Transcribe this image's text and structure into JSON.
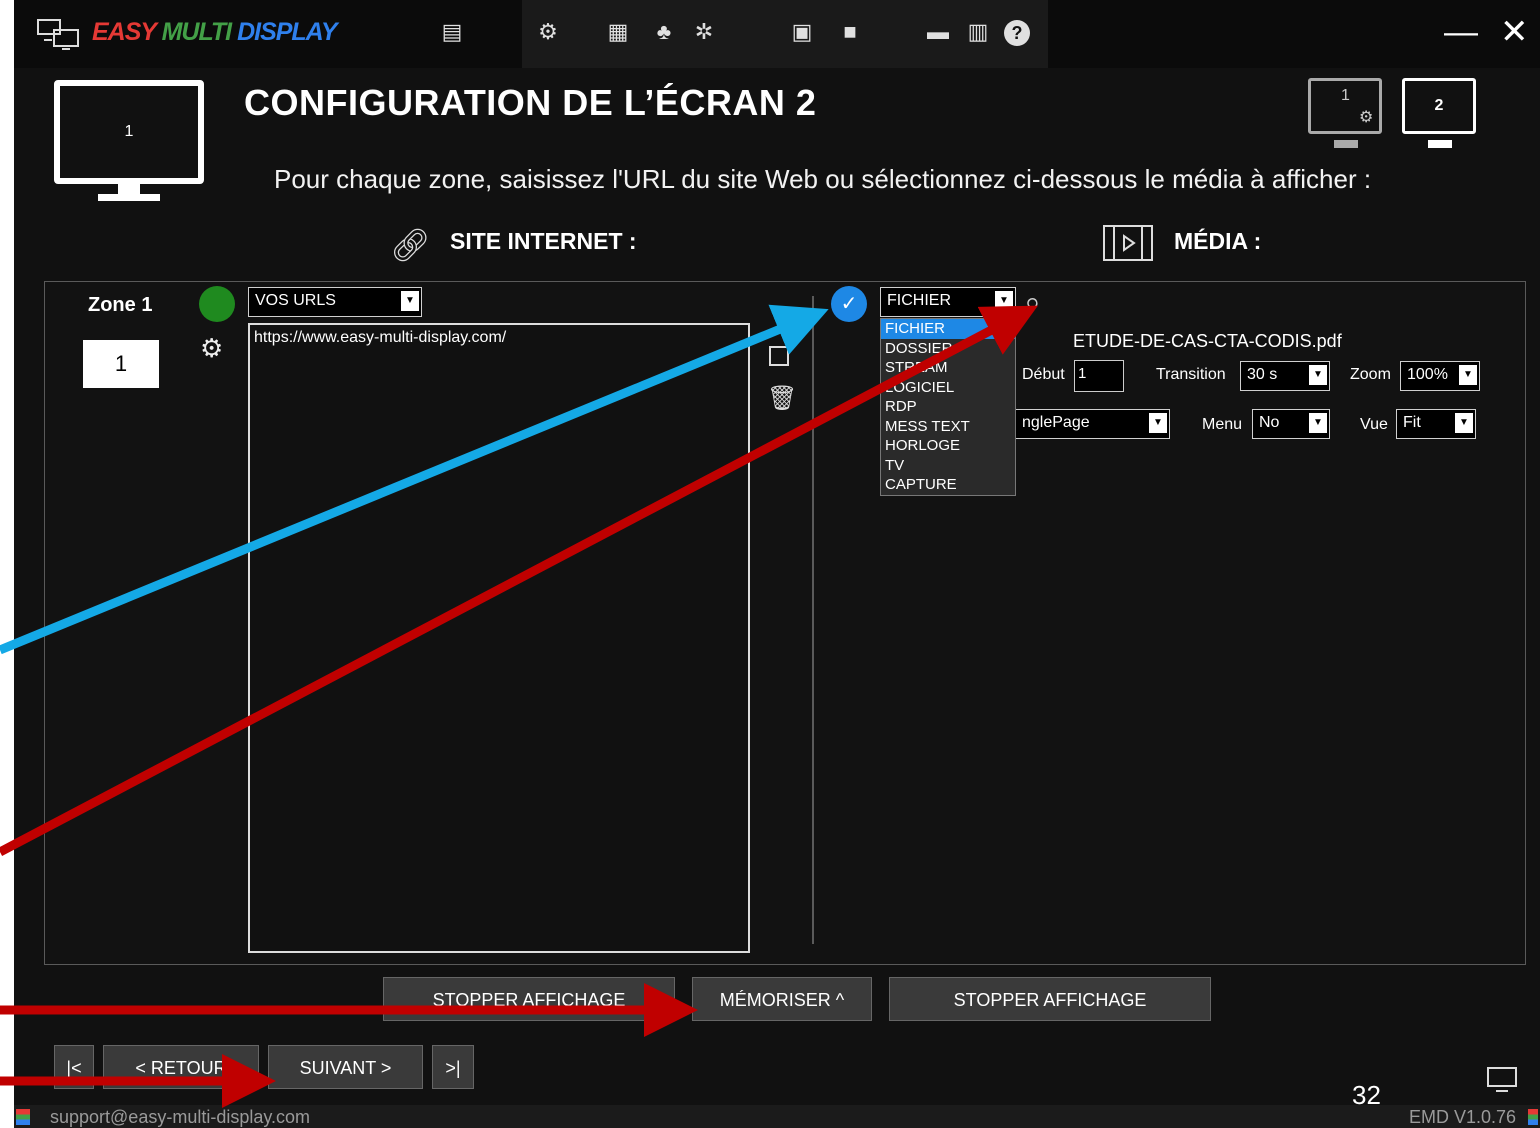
{
  "app": {
    "brand_easy": "EASY",
    "brand_multi": "MULTI",
    "brand_display": "DISPLAY"
  },
  "header": {
    "title": "CONFIGURATION DE L’ÉCRAN 2",
    "subtitle": "Pour chaque zone, saisissez l'URL du site Web ou sélectionnez ci-dessous le média à afficher :",
    "left_monitor": "1",
    "monitor1": "1",
    "monitor2": "2",
    "site_label": "SITE INTERNET :",
    "media_label": "MÉDIA :"
  },
  "zone": {
    "label": "Zone 1",
    "number": "1",
    "url_select": "VOS URLS",
    "url_text": "https://www.easy-multi-display.com/"
  },
  "media": {
    "type_select": "FICHIER",
    "options": [
      "FICHIER",
      "DOSSIER",
      "STREAM",
      "LOGICIEL",
      "RDP",
      "MESS TEXT",
      "HORLOGE",
      "TV",
      "CAPTURE"
    ],
    "file_name": "ETUDE-DE-CAS-CTA-CODIS.pdf",
    "debut_label": "Début",
    "debut_value": "1",
    "transition_label": "Transition",
    "transition_value": "30 s",
    "zoom_label": "Zoom",
    "zoom_value": "100%",
    "mode_value": "nglePage",
    "menu_label": "Menu",
    "menu_value": "No",
    "vue_label": "Vue",
    "vue_value": "Fit"
  },
  "buttons": {
    "stop1": "STOPPER AFFICHAGE",
    "memorize": "MÉMORISER ^",
    "stop2": "STOPPER AFFICHAGE",
    "first": "|<",
    "back": "< RETOUR",
    "next": "SUIVANT >",
    "last": ">|"
  },
  "footer": {
    "page_number": "32",
    "email": "support@easy-multi-display.com",
    "version": "EMD V1.0.76"
  },
  "colors": {
    "accent_blue": "#1e88e5",
    "arrow_blue": "#14a9e6",
    "arrow_red": "#c00000",
    "status_green": "#1f8a1f"
  }
}
